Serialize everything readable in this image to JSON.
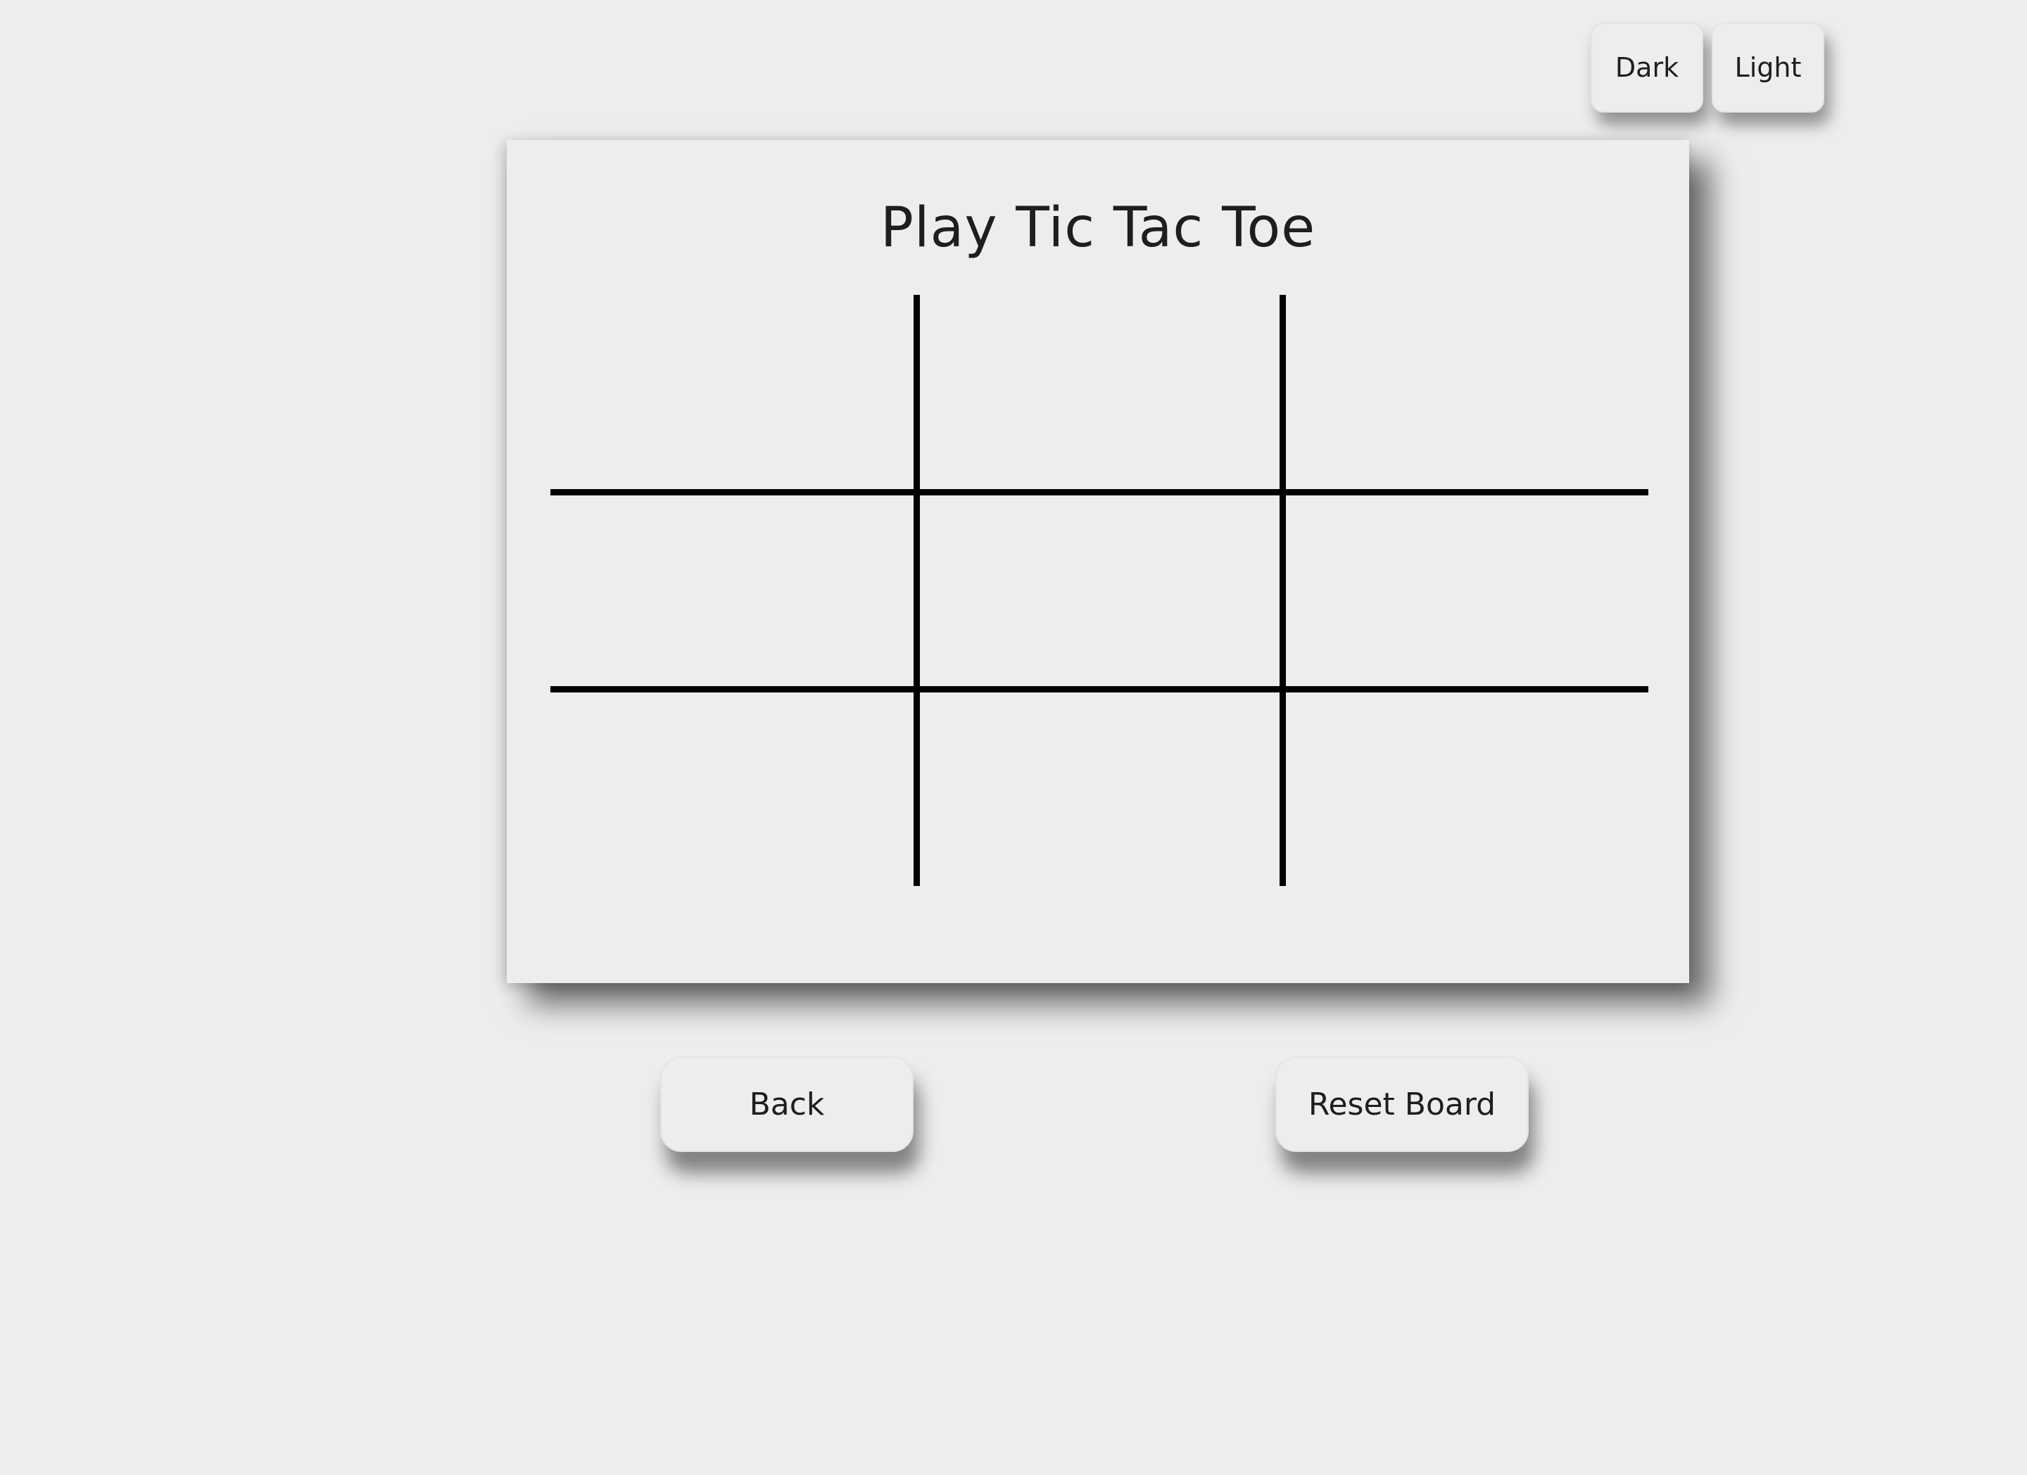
{
  "theme": {
    "dark_label": "Dark",
    "light_label": "Light"
  },
  "game": {
    "title": "Play Tic Tac Toe",
    "cells": [
      "",
      "",
      "",
      "",
      "",
      "",
      "",
      "",
      ""
    ]
  },
  "actions": {
    "back_label": "Back",
    "reset_label": "Reset Board"
  },
  "colors": {
    "background": "#ededed",
    "grid_line": "#000000",
    "text": "#1e1e1e"
  }
}
